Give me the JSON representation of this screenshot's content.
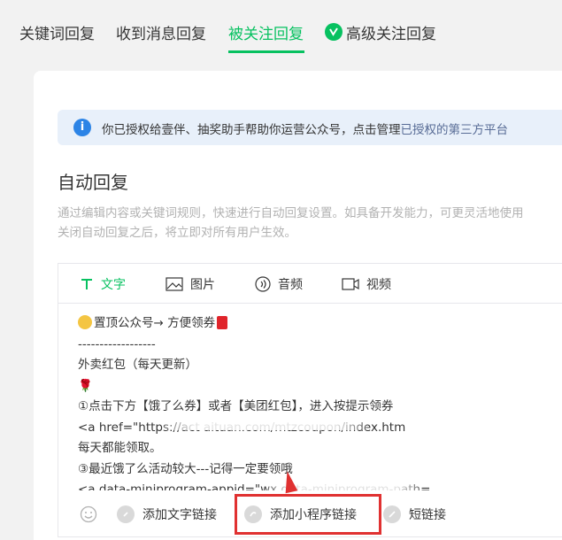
{
  "tabs": [
    {
      "label": "关键词回复"
    },
    {
      "label": "收到消息回复"
    },
    {
      "label": "被关注回复"
    },
    {
      "label": "高级关注回复"
    }
  ],
  "notice": {
    "text": "你已授权给壹伴、抽奖助手帮助你运营公众号，点击管理",
    "link": "已授权的第三方平台"
  },
  "section": {
    "title": "自动回复",
    "desc_line1": "通过编辑内容或关键词规则，快速进行自动回复设置。如具备开发能力，可更灵活地使用",
    "desc_line2": "关闭自动回复之后，将立即对所有用户生效。"
  },
  "editor": {
    "types": [
      {
        "label": "文字",
        "icon": "text-icon"
      },
      {
        "label": "图片",
        "icon": "image-icon"
      },
      {
        "label": "音频",
        "icon": "audio-icon"
      },
      {
        "label": "视频",
        "icon": "video-icon"
      }
    ],
    "lines": [
      "置顶公众号→ 方便领券",
      "------------------",
      "外卖红包（每天更新）",
      "🌹",
      "①点击下方【饿了么券】或者【美团红包】，进入按提示领券",
      "<a href=\"https://act                        aituan.com/mtzcoupon/index.htm",
      "每天都能领取。",
      "③最近饿了么活动较大---记得一定要领哦",
      "<a data-miniprogram-appid=\"wx           data-miniprogram-path="
    ],
    "toolbar": {
      "add_text_link": "添加文字链接",
      "add_miniprogram_link": "添加小程序链接",
      "short_link": "短链接"
    }
  },
  "colors": {
    "accent": "#07c160",
    "link": "#576b95",
    "notice_bg": "#e8f0fa",
    "highlight": "#e03131"
  }
}
